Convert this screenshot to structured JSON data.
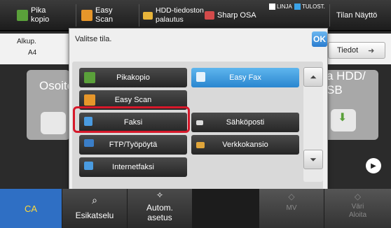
{
  "topbar": {
    "pika_kopio": "Pika\nkopio",
    "easy_scan": "Easy\nScan",
    "hdd": "HDD-tiedoston\npalautus",
    "sharp_osa": "Sharp OSA",
    "linja": "LINJA",
    "tulost": "TULOST.",
    "tilan_naytto": "Tilan Näyttö"
  },
  "home": {
    "alkup_label": "Alkup.",
    "alkup_value": "A4",
    "osoite": "Osoite",
    "tiedot": "Tiedot",
    "right_text": "a HDD/\nSB"
  },
  "dialog": {
    "title": "Valitse tila.",
    "ok_label": "OK",
    "modes": [
      {
        "label": "Pikakopio",
        "icon": "quick-copy-icon",
        "selected": false
      },
      {
        "label": "Easy Fax",
        "icon": "fax-icon",
        "selected": true
      },
      {
        "label": "Easy Scan",
        "icon": "scan-icon",
        "selected": false
      },
      {
        "label": "Faksi",
        "icon": "fax-icon",
        "selected": false
      },
      {
        "label": "Sähköposti",
        "icon": "email-icon",
        "selected": false
      },
      {
        "label": "FTP/Työpöytä",
        "icon": "ftp-icon",
        "selected": false
      },
      {
        "label": "Verkkokansio",
        "icon": "folder-icon",
        "selected": false
      },
      {
        "label": "Internetfaksi",
        "icon": "internet-fax-icon",
        "selected": false
      }
    ]
  },
  "bottombar": {
    "ca": "CA",
    "esikatselu": "Esikatselu",
    "autom": "Autom.\nasetus",
    "mv": "MV",
    "vari": "Väri\nAloita"
  },
  "colors": {
    "accent": "#2a86cf",
    "highlight": "#d7182a",
    "ca_button": "#2f6fc4"
  }
}
